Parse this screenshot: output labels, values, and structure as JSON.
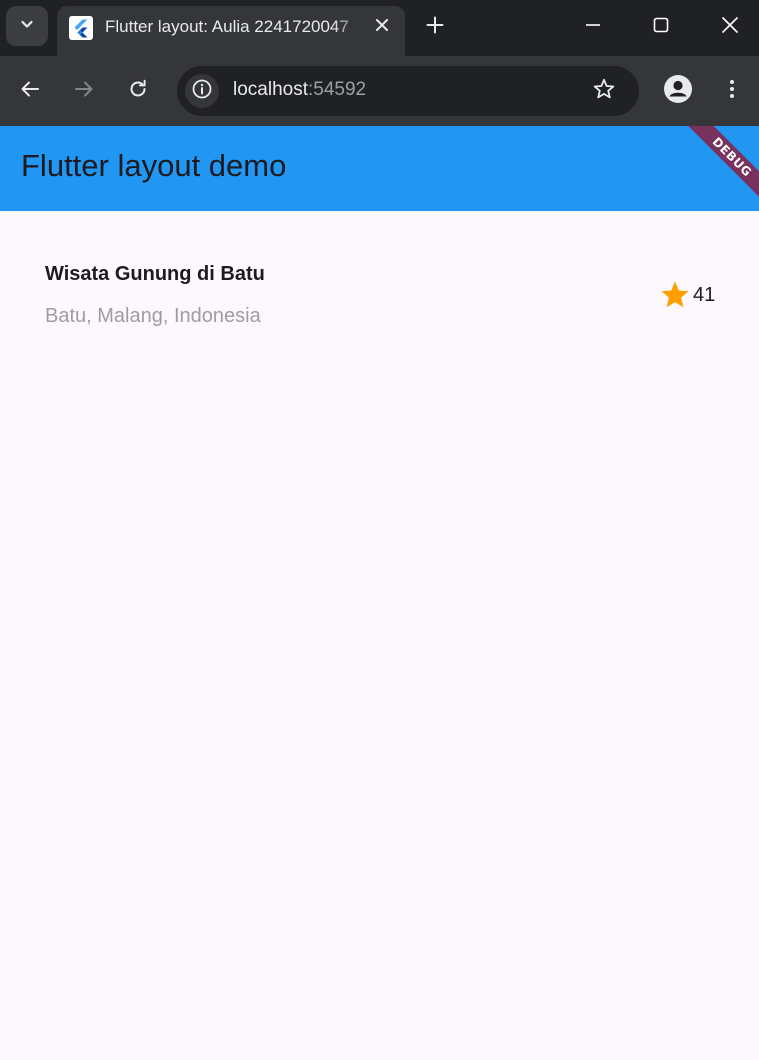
{
  "browser": {
    "tab": {
      "title": "Flutter layout: Aulia 2241720047",
      "favicon": "flutter-logo-icon"
    },
    "toolbar": {
      "url_host": "localhost",
      "url_port": ":54592"
    },
    "icons": {
      "tab_search": "chevron-down-icon",
      "close_tab": "close-icon",
      "new_tab": "plus-icon",
      "minimize": "minimize-icon",
      "maximize": "maximize-icon",
      "close_window": "close-icon",
      "back": "arrow-left-icon",
      "forward": "arrow-right-icon",
      "reload": "reload-icon",
      "site_info": "info-icon",
      "bookmark": "star-outline-icon",
      "profile": "person-icon",
      "menu": "more-vertical-icon"
    }
  },
  "app": {
    "appbar_title": "Flutter layout demo",
    "debug_banner": "DEBUG",
    "title_section": {
      "name": "Wisata Gunung di Batu",
      "location": "Batu, Malang, Indonesia",
      "favorite_count": "41",
      "favorite_icon": "star-icon"
    }
  },
  "colors": {
    "appbar": "#2196f3",
    "background": "#fdf7fe",
    "star": "#ffa000",
    "location_text": "#9e9e9e",
    "debug_banner": "#882142"
  }
}
